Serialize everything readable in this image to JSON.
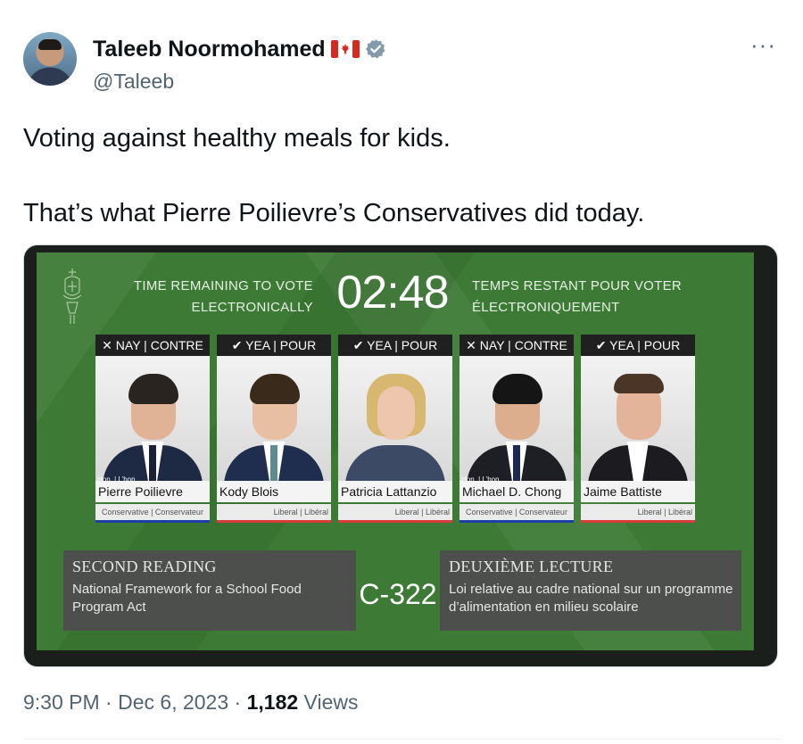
{
  "author": {
    "display_name": "Taleeb Noormohamed",
    "handle": "@Taleeb",
    "flag_icon": "canada-flag-icon",
    "verified_icon": "verified-badge-icon",
    "verified_color": "#829aab"
  },
  "more_icon": "···",
  "tweet": {
    "line1": "Voting against healthy meals for kids.",
    "line2": "That’s what Pierre Poilievre’s Conservatives did today."
  },
  "media": {
    "timer_label_en_line1": "TIME REMAINING TO VOTE",
    "timer_label_en_line2": "ELECTRONICALLY",
    "timer": "02:48",
    "timer_label_fr_line1": "TEMPS RESTANT POUR VOTER",
    "timer_label_fr_line2": "ÉLECTRONIQUEMENT",
    "members": [
      {
        "vote": "✕ NAY | CONTRE",
        "honorific": "Hon. | L’hon.",
        "name": "Pierre Poilievre",
        "party": "Conservative | Conservateur",
        "party_color": "#1f3fa8"
      },
      {
        "vote": "✔ YEA | POUR",
        "honorific": "",
        "name": "Kody Blois",
        "party": "Liberal | Libéral",
        "party_color": "#d93a3a"
      },
      {
        "vote": "✔ YEA | POUR",
        "honorific": "",
        "name": "Patricia Lattanzio",
        "party": "Liberal | Libéral",
        "party_color": "#d93a3a"
      },
      {
        "vote": "✕ NAY | CONTRE",
        "honorific": "Hon. | L’hon.",
        "name": "Michael D. Chong",
        "party": "Conservative | Conservateur",
        "party_color": "#1f3fa8"
      },
      {
        "vote": "✔ YEA | POUR",
        "honorific": "",
        "name": "Jaime Battiste",
        "party": "Liberal | Libéral",
        "party_color": "#d93a3a"
      }
    ],
    "bill": {
      "reading_en": "SECOND READING",
      "title_en": "National Framework for a School Food Program Act",
      "number": "C-322",
      "reading_fr": "DEUXIÈME LECTURE",
      "title_fr": "Loi relative au cadre national sur un programme d’alimentation en milieu scolaire"
    }
  },
  "meta": {
    "time": "9:30 PM",
    "separator": "·",
    "date": "Dec 6, 2023",
    "views_count": "1,182",
    "views_label": "Views"
  }
}
